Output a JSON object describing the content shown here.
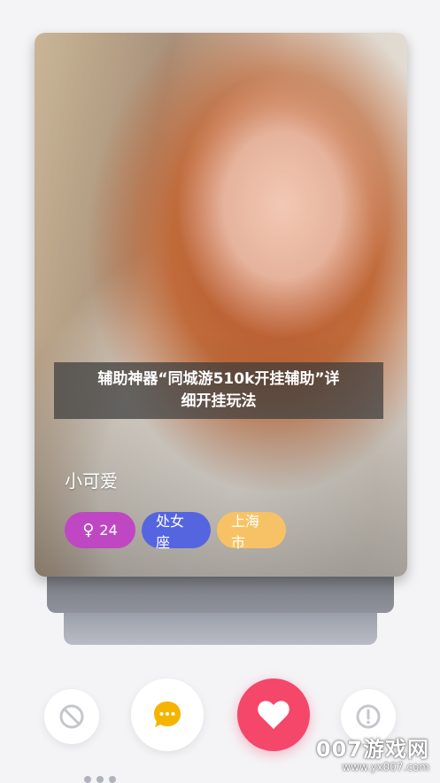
{
  "overlay": {
    "line1": "辅助神器“同城游510k开挂辅助”详",
    "line2": "细开挂玩法"
  },
  "profile": {
    "name": "小可爱",
    "tags": {
      "gender_symbol": "♀",
      "age": "24",
      "zodiac": "处女座",
      "city": "上海市"
    }
  },
  "actions": {
    "skip_icon": "block-icon",
    "chat_icon": "chat-bubble-icon",
    "like_icon": "heart-icon",
    "report_icon": "alert-icon"
  },
  "watermark": {
    "main": "007游戏网",
    "sub": "www.yx007.com"
  },
  "colors": {
    "gender_tag": "#c047c4",
    "zodiac_tag": "#5565e0",
    "city_tag": "#f7c266",
    "like_button": "#f4476a",
    "chat_icon": "#f5b400"
  }
}
